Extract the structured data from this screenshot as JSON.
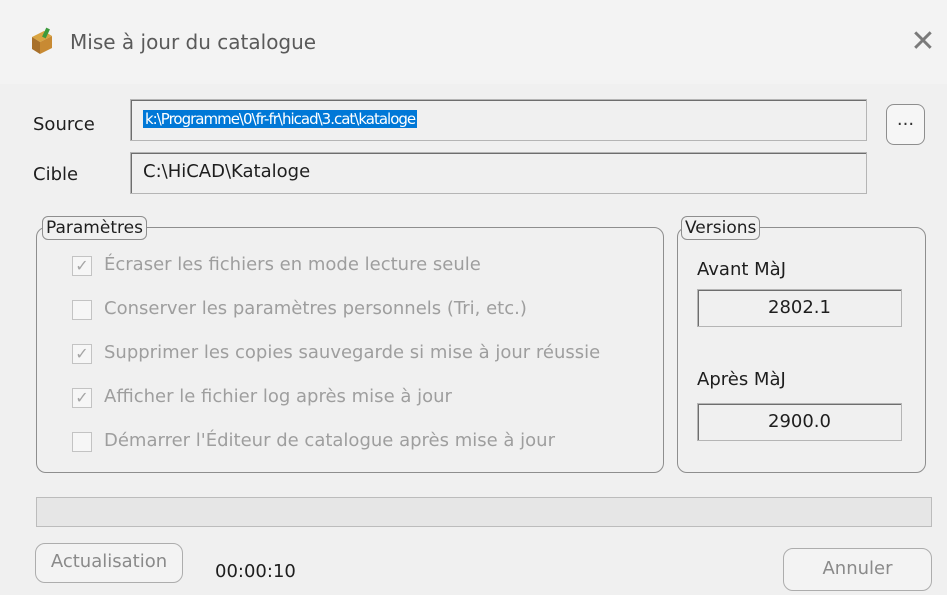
{
  "window": {
    "title": "Mise à jour du catalogue",
    "close_glyph": "✕",
    "app_icon": "catalogue-box-icon"
  },
  "source": {
    "label": "Source",
    "value": "k:\\Programme\\0\\fr-fr\\hicad\\3.cat\\kataloge",
    "browse_label": "..."
  },
  "target": {
    "label": "Cible",
    "value": "C:\\HiCAD\\Kataloge"
  },
  "parameters": {
    "title": "Paramètres",
    "options": [
      {
        "label": "Écraser les fichiers en mode lecture seule",
        "checked": true,
        "mark": "✓"
      },
      {
        "label": "Conserver les paramètres personnels (Tri, etc.)",
        "checked": false,
        "mark": ""
      },
      {
        "label": "Supprimer les copies sauvegarde si mise à jour réussie",
        "checked": true,
        "mark": "✓"
      },
      {
        "label": "Afficher le fichier log après mise à jour",
        "checked": true,
        "mark": "✓"
      },
      {
        "label": "Démarrer l'Éditeur de catalogue après mise à jour",
        "checked": false,
        "mark": ""
      }
    ]
  },
  "versions": {
    "title": "Versions",
    "before_label": "Avant MàJ",
    "before_value": "2802.1",
    "after_label": "Après MàJ",
    "after_value": "2900.0"
  },
  "progress": {
    "fraction": 0
  },
  "footer": {
    "refresh_label": "Actualisation",
    "elapsed": "00:00:10",
    "cancel_label": "Annuler"
  },
  "colors": {
    "selection": "#0078d7",
    "disabled_text": "#9e9e9e"
  }
}
